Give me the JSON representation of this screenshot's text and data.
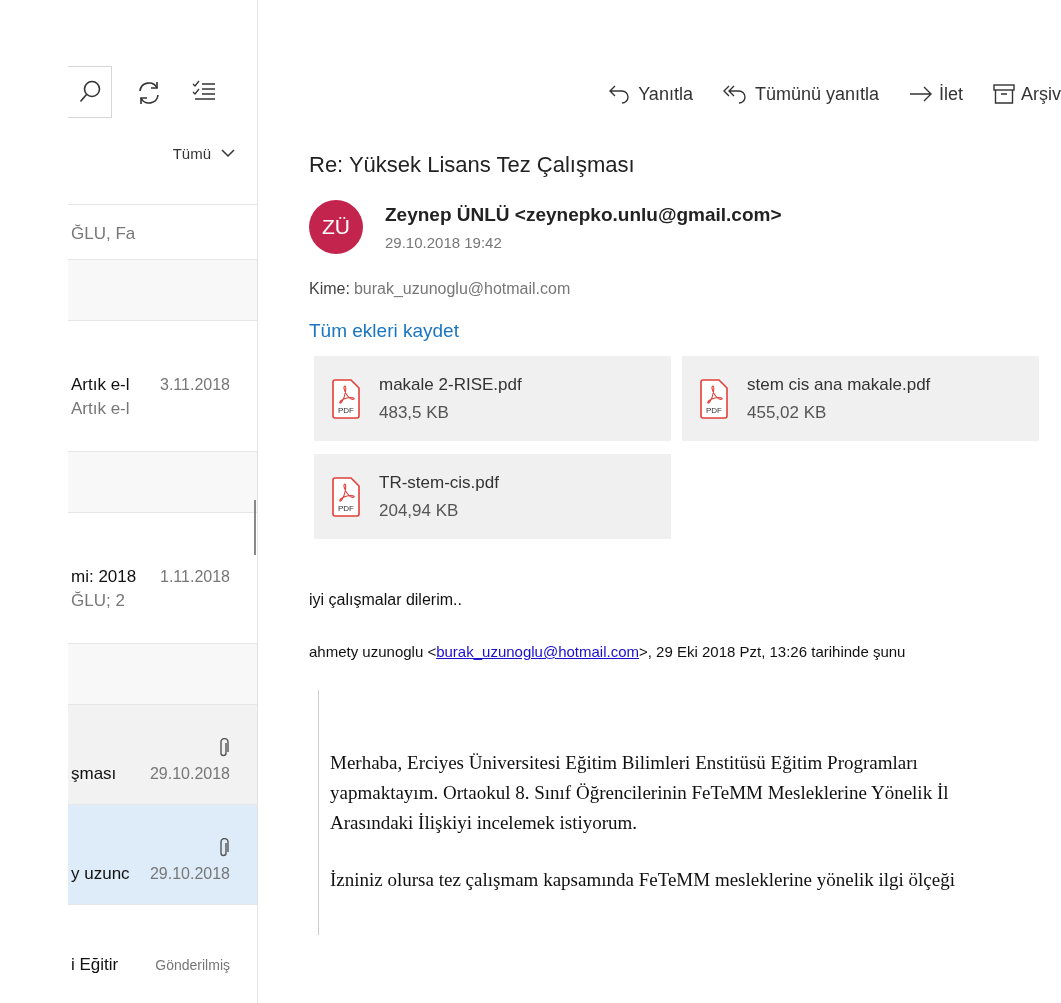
{
  "mail_list": {
    "filter": "Tümü",
    "rows": [
      {
        "kind": "message",
        "selected": false,
        "hovered": false,
        "attachment": false,
        "line_2": "ĞLU, Fa"
      },
      {
        "kind": "group"
      },
      {
        "kind": "message",
        "selected": false,
        "hovered": false,
        "attachment": false,
        "line_1": "Artık e-l",
        "date": "3.11.2018",
        "line_2": "Artık e-l"
      },
      {
        "kind": "group"
      },
      {
        "kind": "message",
        "selected": false,
        "hovered": false,
        "attachment": false,
        "line_1": "mi: 2018",
        "date": "1.11.2018",
        "line_2": "ĞLU; 2"
      },
      {
        "kind": "group"
      },
      {
        "kind": "message",
        "selected": false,
        "hovered": true,
        "attachment": true,
        "line_1": "şması",
        "date": "29.10.2018"
      },
      {
        "kind": "message",
        "selected": true,
        "hovered": false,
        "attachment": true,
        "line_1": "y uzunc",
        "date": "29.10.2018"
      },
      {
        "kind": "message",
        "selected": false,
        "hovered": false,
        "attachment": false,
        "line_1": "i Eğitir",
        "status": "Gönderilmiş"
      }
    ]
  },
  "toolbar": [
    {
      "kind": "reply",
      "label": "Yanıtla"
    },
    {
      "kind": "reply_all",
      "label": "Tümünü yanıtla"
    },
    {
      "kind": "forward",
      "label": "İlet"
    },
    {
      "kind": "archive",
      "label": "Arşiv"
    }
  ],
  "message": {
    "subject": "Re: Yüksek Lisans Tez Çalışması",
    "avatar_initials": "ZÜ",
    "sender": "Zeynep ÜNLÜ <zeynepko.unlu@gmail.com>",
    "date": "29.10.2018 19:42",
    "to_label": "Kime:",
    "to": "burak_uzunoglu@hotmail.com",
    "save_all": "Tüm ekleri kaydet",
    "attachments": [
      {
        "kind": "pdf",
        "type_label": "PDF",
        "name": "makale 2-RISE.pdf",
        "size": "483,5 KB"
      },
      {
        "kind": "pdf",
        "type_label": "PDF",
        "name": "stem cis ana makale.pdf",
        "size": "455,02 KB"
      },
      {
        "kind": "pdf",
        "type_label": "PDF",
        "name": "TR-stem-cis.pdf",
        "size": "204,94 KB"
      }
    ],
    "body": "iyi çalışmalar dilerim..",
    "quote_header": {
      "before": "ahmety uzunoglu <",
      "link": "burak_uzunoglu@hotmail.com",
      "after": ">, 29 Eki 2018 Pzt, 13:26 tarihinde şunu"
    },
    "quote_paragraphs": [
      [
        "Merhaba, Erciyes Üniversitesi Eğitim Bilimleri Enstitüsü Eğitim Programları",
        "yapmaktayım. Ortaokul 8. Sınıf Öğrencilerinin FeTeMM Mesleklerine Yönelik İl",
        "Arasındaki İlişkiyi incelemek istiyorum."
      ],
      [
        "İzniniz olursa tez çalışmam kapsamında FeTeMM mesleklerine yönelik ilgi ölçeği"
      ]
    ]
  }
}
